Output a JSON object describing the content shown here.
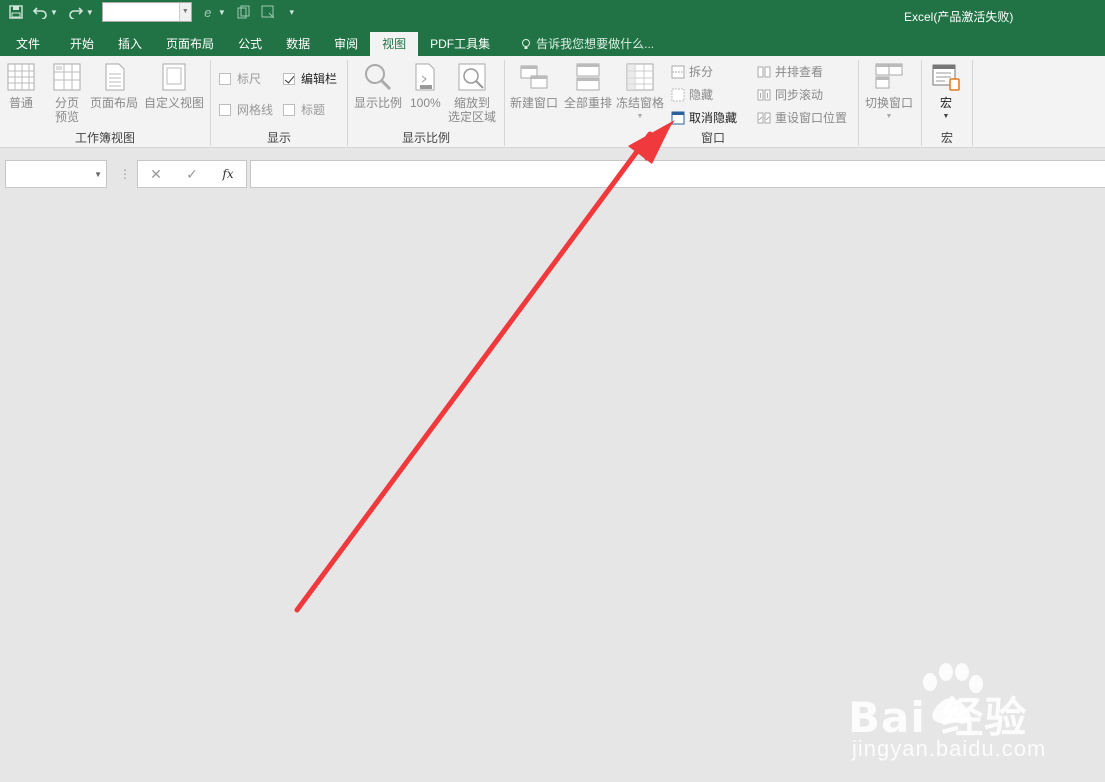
{
  "app": {
    "title": "Excel(产品激活失败)"
  },
  "tabs": [
    {
      "label": "文件"
    },
    {
      "label": "开始"
    },
    {
      "label": "插入"
    },
    {
      "label": "页面布局"
    },
    {
      "label": "公式"
    },
    {
      "label": "数据"
    },
    {
      "label": "审阅"
    },
    {
      "label": "视图",
      "active": true
    },
    {
      "label": "PDF工具集"
    }
  ],
  "tellme": {
    "text": "告诉我您想要做什么..."
  },
  "ribbon": {
    "workbook_views": {
      "label": "工作簿视图",
      "normal": "普通",
      "page_break_1": "分页",
      "page_break_2": "预览",
      "page_layout": "页面布局",
      "custom_views": "自定义视图"
    },
    "show": {
      "label": "显示",
      "ruler": "标尺",
      "formula_bar": "编辑栏",
      "gridlines": "网格线",
      "headings": "标题"
    },
    "zoom": {
      "label": "显示比例",
      "zoom": "显示比例",
      "hundred": "100%",
      "zoom_selection_1": "缩放到",
      "zoom_selection_2": "选定区域"
    },
    "window": {
      "label": "窗口",
      "new_window": "新建窗口",
      "arrange_all": "全部重排",
      "freeze_panes": "冻结窗格",
      "split": "拆分",
      "hide": "隐藏",
      "unhide": "取消隐藏",
      "side_by_side": "并排查看",
      "sync_scroll": "同步滚动",
      "reset_position": "重设窗口位置",
      "switch_windows": "切换窗口"
    },
    "macros": {
      "label": "宏",
      "macros": "宏"
    }
  },
  "formula_bar": {
    "fx": "fx",
    "cancel": "✕",
    "enter": "✓"
  },
  "watermark": {
    "brand": "Bai  经验",
    "site": "jingyan.baidu.com"
  },
  "colors": {
    "excel_green": "#217346",
    "arrow_red": "#f0393c"
  }
}
